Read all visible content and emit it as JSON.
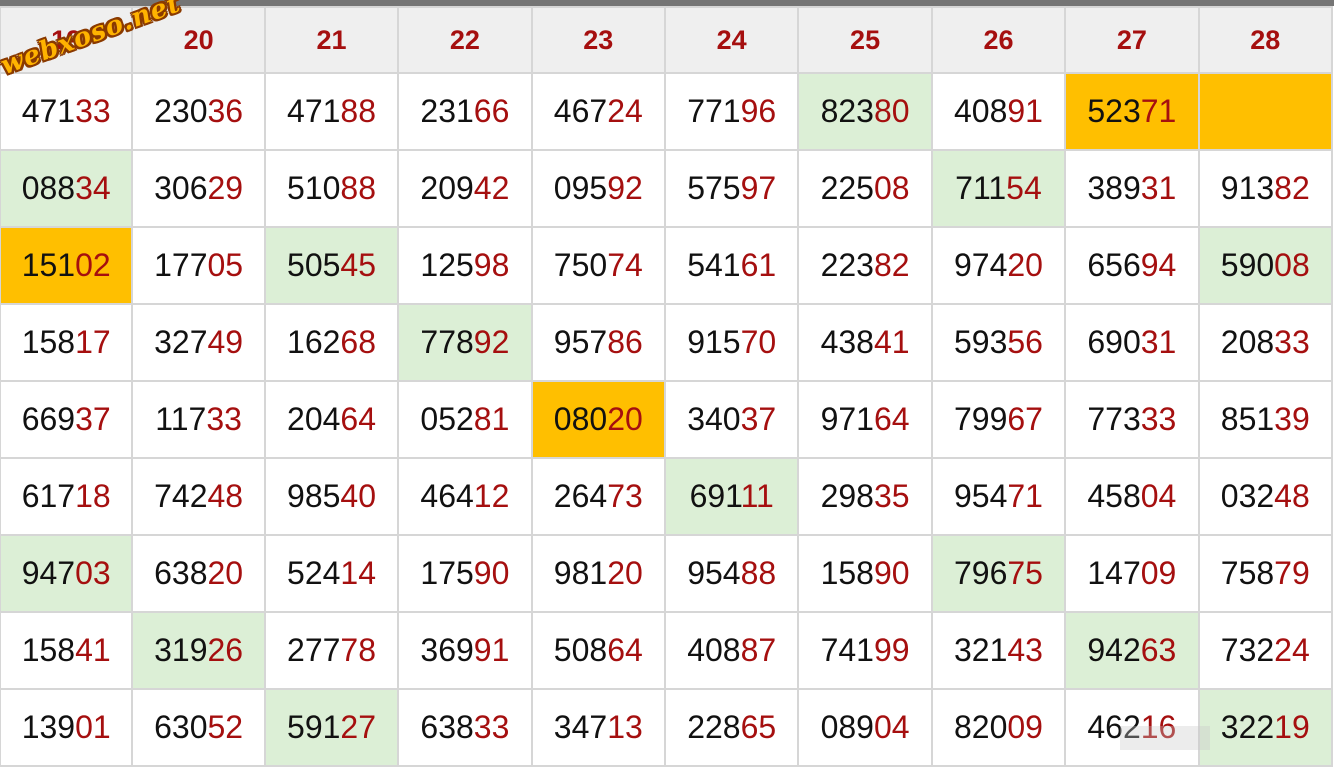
{
  "watermark": "webxoso.net",
  "colors": {
    "header_bg": "#efefef",
    "header_text": "#a50f0f",
    "tail_digits": "#a50f0f",
    "green_highlight": "#dcefd6",
    "gold_highlight": "#ffbf00",
    "top_bar": "#757575"
  },
  "columns": [
    "19",
    "20",
    "21",
    "22",
    "23",
    "24",
    "25",
    "26",
    "27",
    "28"
  ],
  "rows": [
    [
      {
        "head": "471",
        "tail": "33"
      },
      {
        "head": "230",
        "tail": "36"
      },
      {
        "head": "471",
        "tail": "88"
      },
      {
        "head": "231",
        "tail": "66"
      },
      {
        "head": "467",
        "tail": "24"
      },
      {
        "head": "771",
        "tail": "96"
      },
      {
        "head": "823",
        "tail": "80",
        "hl": "green"
      },
      {
        "head": "408",
        "tail": "91"
      },
      {
        "head": "523",
        "tail": "71",
        "hl": "gold"
      },
      {
        "head": "",
        "tail": "",
        "hl": "gold"
      }
    ],
    [
      {
        "head": "088",
        "tail": "34",
        "hl": "green"
      },
      {
        "head": "306",
        "tail": "29"
      },
      {
        "head": "510",
        "tail": "88"
      },
      {
        "head": "209",
        "tail": "42"
      },
      {
        "head": "095",
        "tail": "92"
      },
      {
        "head": "575",
        "tail": "97"
      },
      {
        "head": "225",
        "tail": "08"
      },
      {
        "head": "711",
        "tail": "54",
        "hl": "green"
      },
      {
        "head": "389",
        "tail": "31"
      },
      {
        "head": "913",
        "tail": "82"
      }
    ],
    [
      {
        "head": "151",
        "tail": "02",
        "hl": "gold"
      },
      {
        "head": "177",
        "tail": "05"
      },
      {
        "head": "505",
        "tail": "45",
        "hl": "green"
      },
      {
        "head": "125",
        "tail": "98"
      },
      {
        "head": "750",
        "tail": "74"
      },
      {
        "head": "541",
        "tail": "61"
      },
      {
        "head": "223",
        "tail": "82"
      },
      {
        "head": "974",
        "tail": "20"
      },
      {
        "head": "656",
        "tail": "94"
      },
      {
        "head": "590",
        "tail": "08",
        "hl": "green"
      }
    ],
    [
      {
        "head": "158",
        "tail": "17"
      },
      {
        "head": "327",
        "tail": "49"
      },
      {
        "head": "162",
        "tail": "68"
      },
      {
        "head": "778",
        "tail": "92",
        "hl": "green"
      },
      {
        "head": "957",
        "tail": "86"
      },
      {
        "head": "915",
        "tail": "70"
      },
      {
        "head": "438",
        "tail": "41"
      },
      {
        "head": "593",
        "tail": "56"
      },
      {
        "head": "690",
        "tail": "31"
      },
      {
        "head": "208",
        "tail": "33"
      }
    ],
    [
      {
        "head": "669",
        "tail": "37"
      },
      {
        "head": "117",
        "tail": "33"
      },
      {
        "head": "204",
        "tail": "64"
      },
      {
        "head": "052",
        "tail": "81"
      },
      {
        "head": "080",
        "tail": "20",
        "hl": "gold"
      },
      {
        "head": "340",
        "tail": "37"
      },
      {
        "head": "971",
        "tail": "64"
      },
      {
        "head": "799",
        "tail": "67"
      },
      {
        "head": "773",
        "tail": "33"
      },
      {
        "head": "851",
        "tail": "39"
      }
    ],
    [
      {
        "head": "617",
        "tail": "18"
      },
      {
        "head": "742",
        "tail": "48"
      },
      {
        "head": "985",
        "tail": "40"
      },
      {
        "head": "464",
        "tail": "12"
      },
      {
        "head": "264",
        "tail": "73"
      },
      {
        "head": "691",
        "tail": "11",
        "hl": "green"
      },
      {
        "head": "298",
        "tail": "35"
      },
      {
        "head": "954",
        "tail": "71"
      },
      {
        "head": "458",
        "tail": "04"
      },
      {
        "head": "032",
        "tail": "48"
      }
    ],
    [
      {
        "head": "947",
        "tail": "03",
        "hl": "green"
      },
      {
        "head": "638",
        "tail": "20"
      },
      {
        "head": "524",
        "tail": "14"
      },
      {
        "head": "175",
        "tail": "90"
      },
      {
        "head": "981",
        "tail": "20"
      },
      {
        "head": "954",
        "tail": "88"
      },
      {
        "head": "158",
        "tail": "90"
      },
      {
        "head": "796",
        "tail": "75",
        "hl": "green"
      },
      {
        "head": "147",
        "tail": "09"
      },
      {
        "head": "758",
        "tail": "79"
      }
    ],
    [
      {
        "head": "158",
        "tail": "41"
      },
      {
        "head": "319",
        "tail": "26",
        "hl": "green"
      },
      {
        "head": "277",
        "tail": "78"
      },
      {
        "head": "369",
        "tail": "91"
      },
      {
        "head": "508",
        "tail": "64"
      },
      {
        "head": "408",
        "tail": "87"
      },
      {
        "head": "741",
        "tail": "99"
      },
      {
        "head": "321",
        "tail": "43"
      },
      {
        "head": "942",
        "tail": "63",
        "hl": "green"
      },
      {
        "head": "732",
        "tail": "24"
      }
    ],
    [
      {
        "head": "139",
        "tail": "01"
      },
      {
        "head": "630",
        "tail": "52"
      },
      {
        "head": "591",
        "tail": "27",
        "hl": "green"
      },
      {
        "head": "638",
        "tail": "33"
      },
      {
        "head": "347",
        "tail": "13"
      },
      {
        "head": "228",
        "tail": "65"
      },
      {
        "head": "089",
        "tail": "04"
      },
      {
        "head": "820",
        "tail": "09"
      },
      {
        "head": "462",
        "tail": "16"
      },
      {
        "head": "322",
        "tail": "19",
        "hl": "green"
      }
    ]
  ]
}
